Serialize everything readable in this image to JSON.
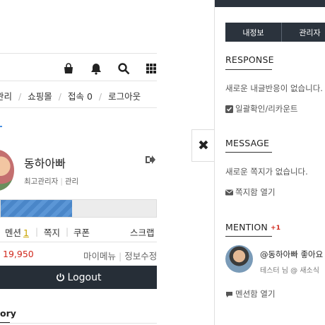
{
  "header": {
    "icons": [
      "shopping-bag-icon",
      "bell-icon",
      "search-icon",
      "grid-icon"
    ]
  },
  "menu": {
    "items": [
      "관리",
      "쇼핑몰",
      "접속 0",
      "로그아웃"
    ]
  },
  "profile": {
    "name": "동하아빠",
    "role": "최고관리자",
    "manage": "관리",
    "level_progress": 0.46
  },
  "tabs": [
    {
      "label": "멘션",
      "count": "1"
    },
    {
      "label": "쪽지"
    },
    {
      "label": "쿠폰"
    },
    {
      "label": "스크랩"
    }
  ],
  "points": {
    "value": "19,950",
    "mymenu": "마이메뉴",
    "edit": "정보수정"
  },
  "logout_button": "Logout",
  "story_tab": "ory",
  "panel": {
    "tabs": [
      "내정보",
      "관리자"
    ],
    "response": {
      "title": "RESPONSE",
      "empty": "새로운 내글반응이 없습니다.",
      "link": "일괄확인/리카운트"
    },
    "message": {
      "title": "MESSAGE",
      "empty": "새로운 쪽지가 없습니다.",
      "link": "쪽지함 열기"
    },
    "mention": {
      "title": "MENTION",
      "badge": "+1",
      "item_title": "@동하아빠 좋아요",
      "item_sub": "테스터 님 @ 새소식",
      "link": "멘션함 열기"
    }
  },
  "colors": {
    "dark": "#2b333d",
    "points": "#d0281c",
    "progress": "#4a86c8"
  }
}
